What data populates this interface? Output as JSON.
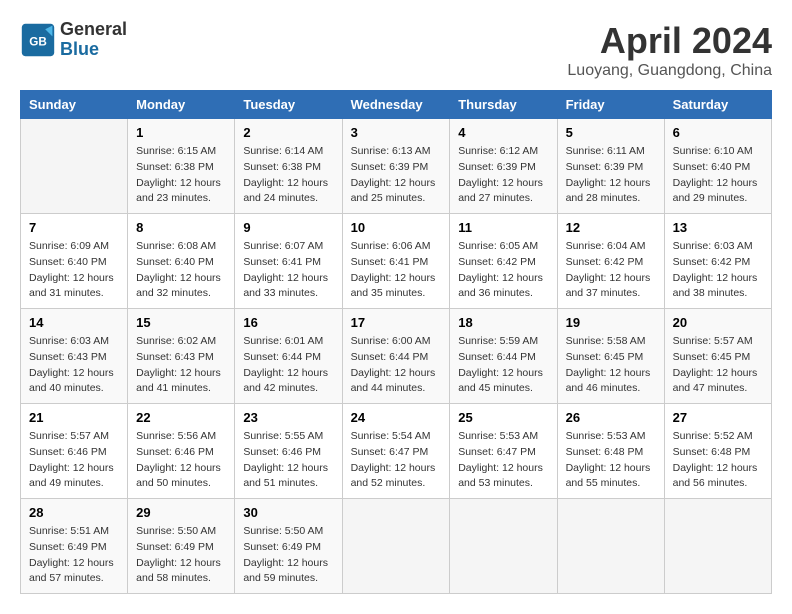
{
  "header": {
    "logo_line1": "General",
    "logo_line2": "Blue",
    "month_title": "April 2024",
    "location": "Luoyang, Guangdong, China"
  },
  "days_of_week": [
    "Sunday",
    "Monday",
    "Tuesday",
    "Wednesday",
    "Thursday",
    "Friday",
    "Saturday"
  ],
  "weeks": [
    [
      {
        "day": "",
        "detail": ""
      },
      {
        "day": "1",
        "detail": "Sunrise: 6:15 AM\nSunset: 6:38 PM\nDaylight: 12 hours\nand 23 minutes."
      },
      {
        "day": "2",
        "detail": "Sunrise: 6:14 AM\nSunset: 6:38 PM\nDaylight: 12 hours\nand 24 minutes."
      },
      {
        "day": "3",
        "detail": "Sunrise: 6:13 AM\nSunset: 6:39 PM\nDaylight: 12 hours\nand 25 minutes."
      },
      {
        "day": "4",
        "detail": "Sunrise: 6:12 AM\nSunset: 6:39 PM\nDaylight: 12 hours\nand 27 minutes."
      },
      {
        "day": "5",
        "detail": "Sunrise: 6:11 AM\nSunset: 6:39 PM\nDaylight: 12 hours\nand 28 minutes."
      },
      {
        "day": "6",
        "detail": "Sunrise: 6:10 AM\nSunset: 6:40 PM\nDaylight: 12 hours\nand 29 minutes."
      }
    ],
    [
      {
        "day": "7",
        "detail": "Sunrise: 6:09 AM\nSunset: 6:40 PM\nDaylight: 12 hours\nand 31 minutes."
      },
      {
        "day": "8",
        "detail": "Sunrise: 6:08 AM\nSunset: 6:40 PM\nDaylight: 12 hours\nand 32 minutes."
      },
      {
        "day": "9",
        "detail": "Sunrise: 6:07 AM\nSunset: 6:41 PM\nDaylight: 12 hours\nand 33 minutes."
      },
      {
        "day": "10",
        "detail": "Sunrise: 6:06 AM\nSunset: 6:41 PM\nDaylight: 12 hours\nand 35 minutes."
      },
      {
        "day": "11",
        "detail": "Sunrise: 6:05 AM\nSunset: 6:42 PM\nDaylight: 12 hours\nand 36 minutes."
      },
      {
        "day": "12",
        "detail": "Sunrise: 6:04 AM\nSunset: 6:42 PM\nDaylight: 12 hours\nand 37 minutes."
      },
      {
        "day": "13",
        "detail": "Sunrise: 6:03 AM\nSunset: 6:42 PM\nDaylight: 12 hours\nand 38 minutes."
      }
    ],
    [
      {
        "day": "14",
        "detail": "Sunrise: 6:03 AM\nSunset: 6:43 PM\nDaylight: 12 hours\nand 40 minutes."
      },
      {
        "day": "15",
        "detail": "Sunrise: 6:02 AM\nSunset: 6:43 PM\nDaylight: 12 hours\nand 41 minutes."
      },
      {
        "day": "16",
        "detail": "Sunrise: 6:01 AM\nSunset: 6:44 PM\nDaylight: 12 hours\nand 42 minutes."
      },
      {
        "day": "17",
        "detail": "Sunrise: 6:00 AM\nSunset: 6:44 PM\nDaylight: 12 hours\nand 44 minutes."
      },
      {
        "day": "18",
        "detail": "Sunrise: 5:59 AM\nSunset: 6:44 PM\nDaylight: 12 hours\nand 45 minutes."
      },
      {
        "day": "19",
        "detail": "Sunrise: 5:58 AM\nSunset: 6:45 PM\nDaylight: 12 hours\nand 46 minutes."
      },
      {
        "day": "20",
        "detail": "Sunrise: 5:57 AM\nSunset: 6:45 PM\nDaylight: 12 hours\nand 47 minutes."
      }
    ],
    [
      {
        "day": "21",
        "detail": "Sunrise: 5:57 AM\nSunset: 6:46 PM\nDaylight: 12 hours\nand 49 minutes."
      },
      {
        "day": "22",
        "detail": "Sunrise: 5:56 AM\nSunset: 6:46 PM\nDaylight: 12 hours\nand 50 minutes."
      },
      {
        "day": "23",
        "detail": "Sunrise: 5:55 AM\nSunset: 6:46 PM\nDaylight: 12 hours\nand 51 minutes."
      },
      {
        "day": "24",
        "detail": "Sunrise: 5:54 AM\nSunset: 6:47 PM\nDaylight: 12 hours\nand 52 minutes."
      },
      {
        "day": "25",
        "detail": "Sunrise: 5:53 AM\nSunset: 6:47 PM\nDaylight: 12 hours\nand 53 minutes."
      },
      {
        "day": "26",
        "detail": "Sunrise: 5:53 AM\nSunset: 6:48 PM\nDaylight: 12 hours\nand 55 minutes."
      },
      {
        "day": "27",
        "detail": "Sunrise: 5:52 AM\nSunset: 6:48 PM\nDaylight: 12 hours\nand 56 minutes."
      }
    ],
    [
      {
        "day": "28",
        "detail": "Sunrise: 5:51 AM\nSunset: 6:49 PM\nDaylight: 12 hours\nand 57 minutes."
      },
      {
        "day": "29",
        "detail": "Sunrise: 5:50 AM\nSunset: 6:49 PM\nDaylight: 12 hours\nand 58 minutes."
      },
      {
        "day": "30",
        "detail": "Sunrise: 5:50 AM\nSunset: 6:49 PM\nDaylight: 12 hours\nand 59 minutes."
      },
      {
        "day": "",
        "detail": ""
      },
      {
        "day": "",
        "detail": ""
      },
      {
        "day": "",
        "detail": ""
      },
      {
        "day": "",
        "detail": ""
      }
    ]
  ]
}
